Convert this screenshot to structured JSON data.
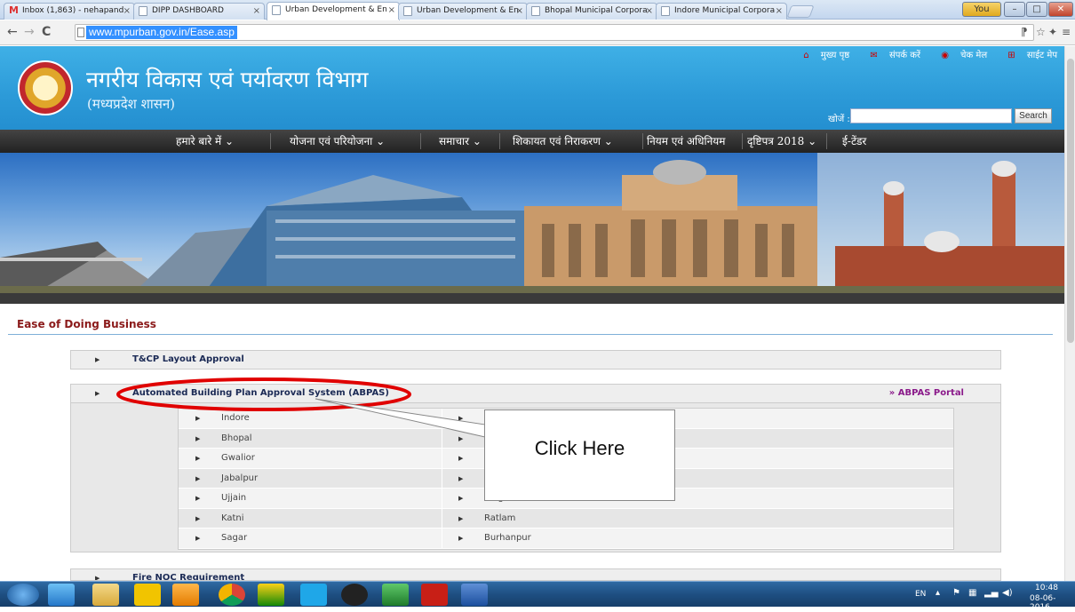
{
  "browser": {
    "tabs": [
      {
        "label": "Inbox (1,863) - nehapand"
      },
      {
        "label": "DIPP DASHBOARD"
      },
      {
        "label": "Urban Development & En"
      },
      {
        "label": "Urban Development & En"
      },
      {
        "label": "Bhopal Municipal Corpora"
      },
      {
        "label": "Indore Municipal Corpora"
      }
    ],
    "user_badge": "You",
    "url": "www.mpurban.gov.in/Ease.asp"
  },
  "site": {
    "title": "नगरीय विकास एवं पर्यावरण विभाग",
    "subtitle": "(मध्यप्रदेश शासन)",
    "top_links": [
      "मुख्य पृष्ठ",
      "संपर्क करें",
      "चेक मेल",
      "साईट मेप"
    ],
    "search_label": "खोजें :",
    "search_value": "",
    "search_button": "Search",
    "nav": [
      "हमारे बारे में ⌄",
      "योजना एवं परियोजना ⌄",
      "समाचार ⌄",
      "शिकायत एवं निराकरण ⌄",
      "नियम एवं अधिनियम",
      "दृष्टिपत्र 2018 ⌄",
      "ई-टेंडर"
    ]
  },
  "main": {
    "section_title": "Ease of Doing Business",
    "accordion": [
      {
        "label": "T&CP Layout Approval"
      },
      {
        "label": "Automated Building Plan Approval System (ABPAS)",
        "link": "» ABPAS Portal"
      },
      {
        "label": "Fire NOC Requirement"
      }
    ],
    "cities_left": [
      "Indore",
      "Bhopal",
      "Gwalior",
      "Jabalpur",
      "Ujjain",
      "Katni",
      "Sagar"
    ],
    "cities_right": [
      "",
      "",
      "",
      "",
      "Singrauli",
      "Ratlam",
      "Burhanpur"
    ]
  },
  "annotation": {
    "callout_text": "Click Here",
    "highlight_color": "#e00000"
  },
  "taskbar": {
    "lang": "EN",
    "time": "10:48",
    "date": "08-06-2016"
  }
}
